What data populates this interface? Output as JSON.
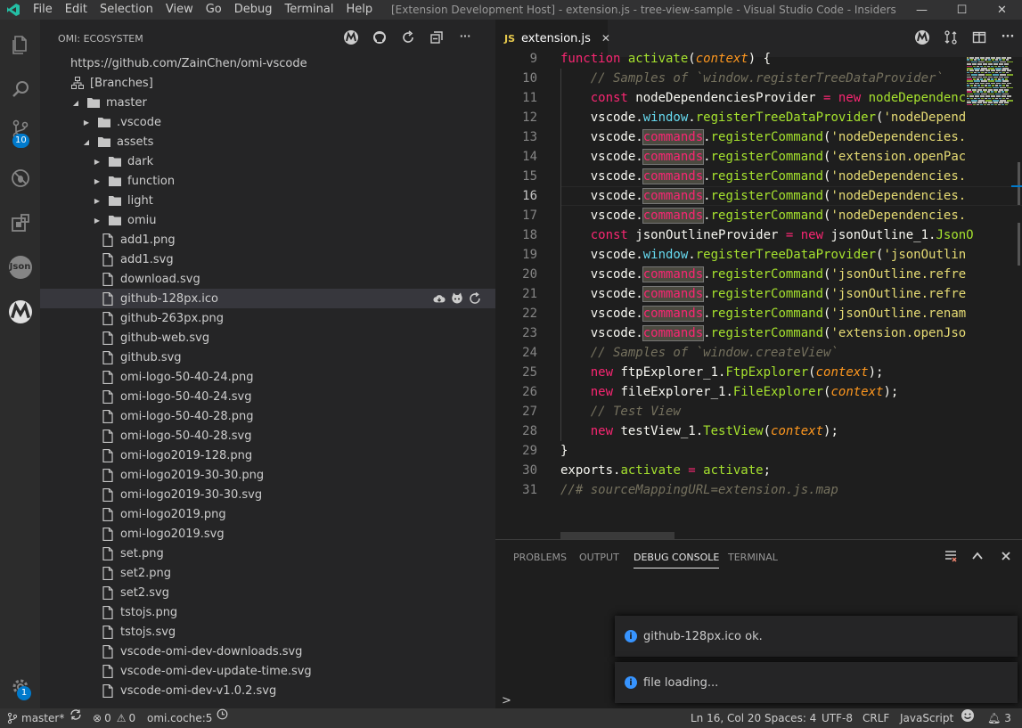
{
  "titlebar": {
    "menu": [
      "File",
      "Edit",
      "Selection",
      "View",
      "Go",
      "Debug",
      "Terminal",
      "Help"
    ],
    "window_title": "[Extension Development Host] - extension.js - tree-view-sample - Visual Studio Code - Insiders [Administ..."
  },
  "activity": {
    "scm_badge": "10",
    "settings_badge": "1",
    "json_label": "Json"
  },
  "sidebar": {
    "title": "OMI: ECOSYSTEM",
    "items": [
      {
        "label": "https://github.com/ZainChen/omi-vscode",
        "type": "link"
      },
      {
        "label": "[Branches]",
        "type": "branches"
      },
      {
        "label": "master",
        "type": "folder-open"
      },
      {
        "label": ".vscode",
        "type": "folder-closed"
      },
      {
        "label": "assets",
        "type": "folder-open"
      },
      {
        "label": "dark",
        "type": "folder-closed"
      },
      {
        "label": "function",
        "type": "folder-closed"
      },
      {
        "label": "light",
        "type": "folder-closed"
      },
      {
        "label": "omiu",
        "type": "folder-closed"
      },
      {
        "label": "add1.png",
        "type": "file"
      },
      {
        "label": "add1.svg",
        "type": "file"
      },
      {
        "label": "download.svg",
        "type": "file"
      },
      {
        "label": "github-128px.ico",
        "type": "file"
      },
      {
        "label": "github-263px.png",
        "type": "file"
      },
      {
        "label": "github-web.svg",
        "type": "file"
      },
      {
        "label": "github.svg",
        "type": "file"
      },
      {
        "label": "omi-logo-50-40-24.png",
        "type": "file"
      },
      {
        "label": "omi-logo-50-40-24.svg",
        "type": "file"
      },
      {
        "label": "omi-logo-50-40-28.png",
        "type": "file"
      },
      {
        "label": "omi-logo-50-40-28.svg",
        "type": "file"
      },
      {
        "label": "omi-logo2019-128.png",
        "type": "file"
      },
      {
        "label": "omi-logo2019-30-30.png",
        "type": "file"
      },
      {
        "label": "omi-logo2019-30-30.svg",
        "type": "file"
      },
      {
        "label": "omi-logo2019.png",
        "type": "file"
      },
      {
        "label": "omi-logo2019.svg",
        "type": "file"
      },
      {
        "label": "set.png",
        "type": "file"
      },
      {
        "label": "set2.png",
        "type": "file"
      },
      {
        "label": "set2.svg",
        "type": "file"
      },
      {
        "label": "tstojs.png",
        "type": "file"
      },
      {
        "label": "tstojs.svg",
        "type": "file"
      },
      {
        "label": "vscode-omi-dev-downloads.svg",
        "type": "file"
      },
      {
        "label": "vscode-omi-dev-update-time.svg",
        "type": "file"
      },
      {
        "label": "vscode-omi-dev-v1.0.2.svg",
        "type": "file"
      }
    ]
  },
  "editor": {
    "tab_prefix": "JS",
    "tab_label": "extension.js",
    "lines": [
      {
        "n": "9",
        "tokens": [
          [
            "kw",
            "function "
          ],
          [
            "fn",
            "activate"
          ],
          [
            "id",
            "("
          ],
          [
            "param",
            "context"
          ],
          [
            "id",
            ") {"
          ]
        ]
      },
      {
        "n": "10",
        "tokens": [
          [
            "cm",
            "    // Samples of `window.registerTreeDataProvider`"
          ]
        ]
      },
      {
        "n": "11",
        "tokens": [
          [
            "kw",
            "    const "
          ],
          [
            "id",
            "nodeDependenciesProvider "
          ],
          [
            "kw",
            "= new "
          ],
          [
            "fn",
            "nodeDependenc"
          ]
        ]
      },
      {
        "n": "12",
        "tokens": [
          [
            "id",
            "    vscode."
          ],
          [
            "prop",
            "window"
          ],
          [
            "id",
            "."
          ],
          [
            "fn",
            "registerTreeDataProvider"
          ],
          [
            "id",
            "("
          ],
          [
            "str",
            "'nodeDepend"
          ]
        ]
      },
      {
        "n": "13",
        "tokens": [
          [
            "id",
            "    vscode."
          ],
          [
            "hl",
            "commands"
          ],
          [
            "id",
            "."
          ],
          [
            "fn",
            "registerCommand"
          ],
          [
            "id",
            "("
          ],
          [
            "str",
            "'nodeDependencies."
          ]
        ]
      },
      {
        "n": "14",
        "tokens": [
          [
            "id",
            "    vscode."
          ],
          [
            "hl",
            "commands"
          ],
          [
            "id",
            "."
          ],
          [
            "fn",
            "registerCommand"
          ],
          [
            "id",
            "("
          ],
          [
            "str",
            "'extension.openPac"
          ]
        ]
      },
      {
        "n": "15",
        "tokens": [
          [
            "id",
            "    vscode."
          ],
          [
            "hl",
            "commands"
          ],
          [
            "id",
            "."
          ],
          [
            "fn",
            "registerCommand"
          ],
          [
            "id",
            "("
          ],
          [
            "str",
            "'nodeDependencies."
          ]
        ]
      },
      {
        "n": "16",
        "tokens": [
          [
            "id",
            "    vscode."
          ],
          [
            "hl",
            "commands"
          ],
          [
            "id",
            "."
          ],
          [
            "fn",
            "registerCommand"
          ],
          [
            "id",
            "("
          ],
          [
            "str",
            "'nodeDependencies."
          ]
        ]
      },
      {
        "n": "17",
        "tokens": [
          [
            "id",
            "    vscode."
          ],
          [
            "hl",
            "commands"
          ],
          [
            "id",
            "."
          ],
          [
            "fn",
            "registerCommand"
          ],
          [
            "id",
            "("
          ],
          [
            "str",
            "'nodeDependencies."
          ]
        ]
      },
      {
        "n": "18",
        "tokens": [
          [
            "kw",
            "    const "
          ],
          [
            "id",
            "jsonOutlineProvider "
          ],
          [
            "kw",
            "= new "
          ],
          [
            "id",
            "jsonOutline_1."
          ],
          [
            "fn",
            "JsonO"
          ]
        ]
      },
      {
        "n": "19",
        "tokens": [
          [
            "id",
            "    vscode."
          ],
          [
            "prop",
            "window"
          ],
          [
            "id",
            "."
          ],
          [
            "fn",
            "registerTreeDataProvider"
          ],
          [
            "id",
            "("
          ],
          [
            "str",
            "'jsonOutlin"
          ]
        ]
      },
      {
        "n": "20",
        "tokens": [
          [
            "id",
            "    vscode."
          ],
          [
            "hl",
            "commands"
          ],
          [
            "id",
            "."
          ],
          [
            "fn",
            "registerCommand"
          ],
          [
            "id",
            "("
          ],
          [
            "str",
            "'jsonOutline.refre"
          ]
        ]
      },
      {
        "n": "21",
        "tokens": [
          [
            "id",
            "    vscode."
          ],
          [
            "hl",
            "commands"
          ],
          [
            "id",
            "."
          ],
          [
            "fn",
            "registerCommand"
          ],
          [
            "id",
            "("
          ],
          [
            "str",
            "'jsonOutline.refre"
          ]
        ]
      },
      {
        "n": "22",
        "tokens": [
          [
            "id",
            "    vscode."
          ],
          [
            "hl",
            "commands"
          ],
          [
            "id",
            "."
          ],
          [
            "fn",
            "registerCommand"
          ],
          [
            "id",
            "("
          ],
          [
            "str",
            "'jsonOutline.renam"
          ]
        ]
      },
      {
        "n": "23",
        "tokens": [
          [
            "id",
            "    vscode."
          ],
          [
            "hl",
            "commands"
          ],
          [
            "id",
            "."
          ],
          [
            "fn",
            "registerCommand"
          ],
          [
            "id",
            "("
          ],
          [
            "str",
            "'extension.openJso"
          ]
        ]
      },
      {
        "n": "24",
        "tokens": [
          [
            "cm",
            "    // Samples of `window.createView`"
          ]
        ]
      },
      {
        "n": "25",
        "tokens": [
          [
            "kw",
            "    new "
          ],
          [
            "id",
            "ftpExplorer_1."
          ],
          [
            "fn",
            "FtpExplorer"
          ],
          [
            "id",
            "("
          ],
          [
            "param2",
            "context"
          ],
          [
            "id",
            ");"
          ]
        ]
      },
      {
        "n": "26",
        "tokens": [
          [
            "kw",
            "    new "
          ],
          [
            "id",
            "fileExplorer_1."
          ],
          [
            "fn",
            "FileExplorer"
          ],
          [
            "id",
            "("
          ],
          [
            "param2",
            "context"
          ],
          [
            "id",
            ");"
          ]
        ]
      },
      {
        "n": "27",
        "tokens": [
          [
            "cm",
            "    // Test View"
          ]
        ]
      },
      {
        "n": "28",
        "tokens": [
          [
            "kw",
            "    new "
          ],
          [
            "id",
            "testView_1."
          ],
          [
            "fn",
            "TestView"
          ],
          [
            "id",
            "("
          ],
          [
            "param2",
            "context"
          ],
          [
            "id",
            ");"
          ]
        ]
      },
      {
        "n": "29",
        "tokens": [
          [
            "id",
            "}"
          ]
        ]
      },
      {
        "n": "30",
        "tokens": [
          [
            "id",
            "exports."
          ],
          [
            "fn",
            "activate "
          ],
          [
            "kw",
            "= "
          ],
          [
            "fn",
            "activate"
          ],
          [
            "id",
            ";"
          ]
        ]
      },
      {
        "n": "31",
        "tokens": [
          [
            "cm",
            "//# sourceMappingURL=extension.js.map"
          ]
        ]
      }
    ],
    "current_line": "16"
  },
  "panel": {
    "tabs": [
      "PROBLEMS",
      "OUTPUT",
      "DEBUG CONSOLE",
      "TERMINAL"
    ],
    "active_tab": "DEBUG CONSOLE",
    "prompt": ">",
    "notifications": [
      "github-128px.ico ok.",
      "file loading..."
    ]
  },
  "statusbar": {
    "branch": "master*",
    "errors": "0",
    "warnings": "0",
    "omi": "omi.coche:5",
    "position": "Ln 16, Col 20",
    "spaces": "Spaces: 4",
    "encoding": "UTF-8",
    "eol": "CRLF",
    "language": "JavaScript",
    "notif_count": "3"
  },
  "colors": {
    "accent": "#007acc",
    "keyword": "#f92672",
    "function": "#a6e22e",
    "string": "#e6db74",
    "comment": "#75715e",
    "param": "#fd971f",
    "property": "#66d9ef"
  }
}
